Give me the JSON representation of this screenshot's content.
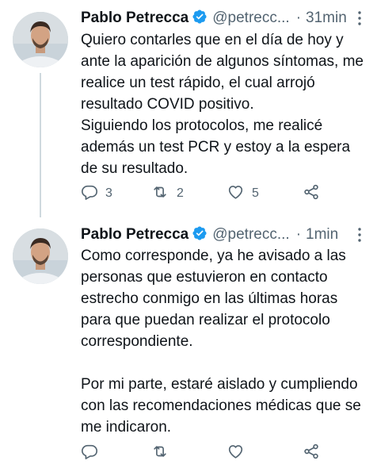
{
  "colors": {
    "text": "#0f1419",
    "secondary": "#536471",
    "verified": "#1d9bf0",
    "thread_line": "#cfd9de"
  },
  "tweets": [
    {
      "author": {
        "name": "Pablo Petrecca",
        "handle": "@petrecc...",
        "verified": true,
        "avatar_icon": "profile-photo"
      },
      "separator": "·",
      "time": "31min",
      "text": "Quiero contarles que en el día de hoy y ante la aparición de algunos síntomas, me realice un test rápido, el cual arrojó resultado COVID positivo.\nSiguiendo los protocolos, me realicé además un test PCR y estoy a la espera de su resultado.",
      "actions": {
        "reply": {
          "icon": "reply-icon",
          "count": "3"
        },
        "retweet": {
          "icon": "retweet-icon",
          "count": "2"
        },
        "like": {
          "icon": "heart-icon",
          "count": "5"
        },
        "share": {
          "icon": "share-icon"
        }
      }
    },
    {
      "author": {
        "name": "Pablo Petrecca",
        "handle": "@petrecc...",
        "verified": true,
        "avatar_icon": "profile-photo"
      },
      "separator": "·",
      "time": "1min",
      "text": "Como corresponde, ya he avisado a las personas que estuvieron en contacto estrecho conmigo en las últimas horas para que puedan realizar el protocolo correspondiente.\n\nPor mi parte, estaré aislado y cumpliendo con las recomendaciones médicas que se me indicaron.",
      "actions": {
        "reply": {
          "icon": "reply-icon",
          "count": ""
        },
        "retweet": {
          "icon": "retweet-icon",
          "count": ""
        },
        "like": {
          "icon": "heart-icon",
          "count": ""
        },
        "share": {
          "icon": "share-icon"
        }
      }
    }
  ]
}
